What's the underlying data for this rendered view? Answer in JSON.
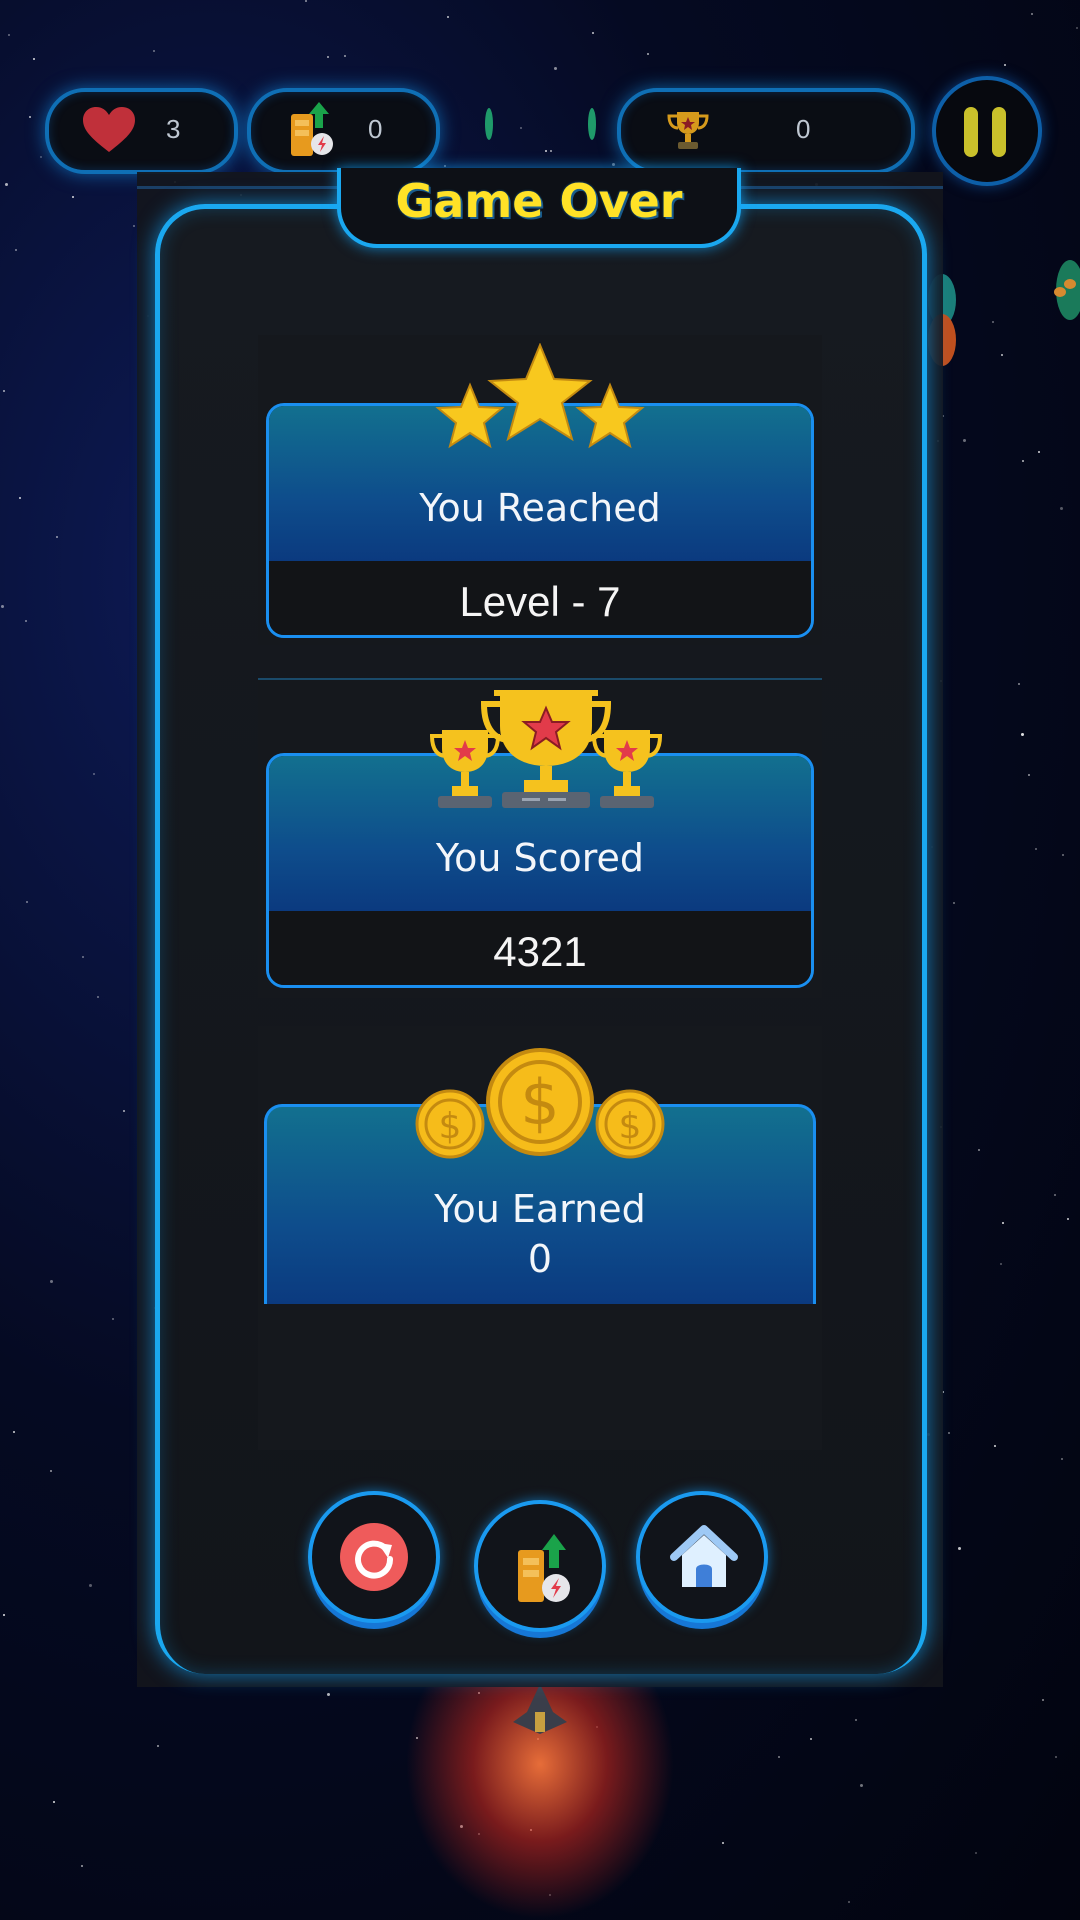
{
  "hud": {
    "lives": "3",
    "boost": "0",
    "trophies": "0"
  },
  "dialog": {
    "title": "Game Over",
    "level_label": "You Reached",
    "level_value": "Level - 7",
    "score_label": "You Scored",
    "score_value": "4321",
    "earned_label": "You Earned",
    "earned_value": "0"
  },
  "icons": {
    "lives": "heart-icon",
    "boost": "battery-boost-icon",
    "trophy": "trophy-icon",
    "pause": "pause-icon",
    "stars": "three-stars-icon",
    "trophies": "three-trophies-icon",
    "coins": "three-coins-icon",
    "restart": "restart-icon",
    "boost_button": "battery-boost-icon",
    "home": "home-icon"
  },
  "colors": {
    "accent": "#1aa8f0",
    "title": "#ffe227",
    "card_top": "#0e4d8c"
  }
}
